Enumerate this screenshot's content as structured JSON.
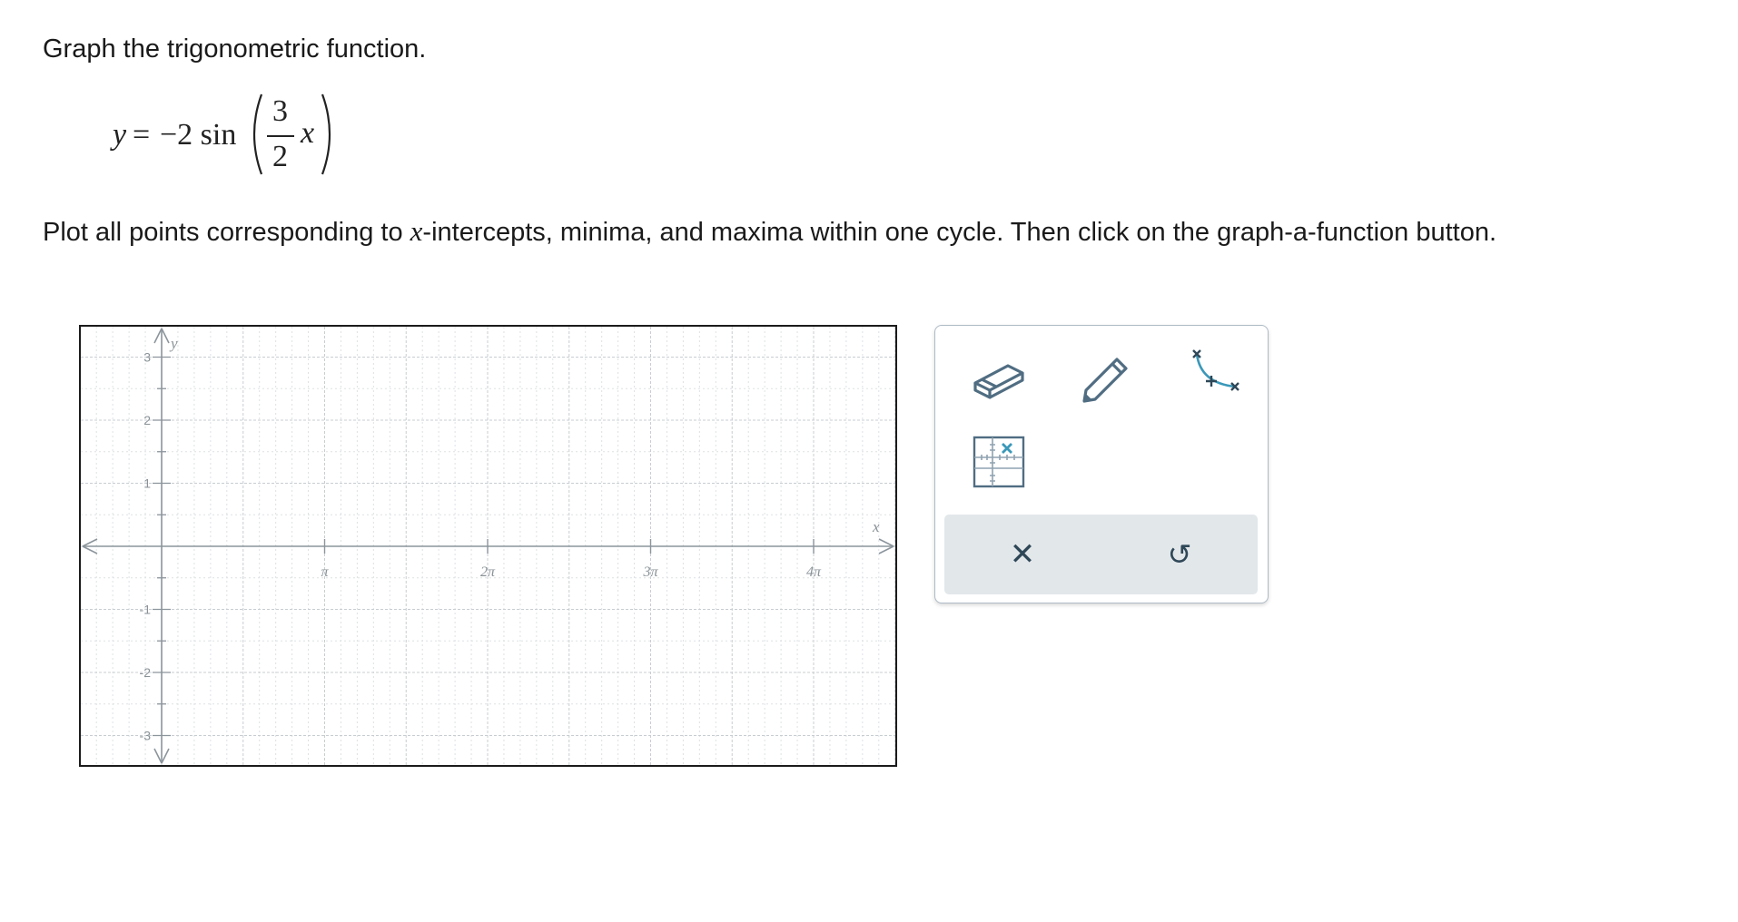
{
  "prompt": "Graph the trigonometric function.",
  "equation": {
    "lhs": "y",
    "equals": "=",
    "coefficient": "−2 sin",
    "numerator": "3",
    "denominator": "2",
    "variable": "x"
  },
  "instructions": {
    "before": "Plot all points corresponding to ",
    "var": "x",
    "after": "-intercepts, minima, and maxima within one cycle. Then click on the graph-a-function button."
  },
  "graph": {
    "x_axis_label": "x",
    "y_axis_label": "y",
    "x_tick_labels": [
      "π",
      "2π",
      "3π",
      "4π"
    ],
    "y_tick_labels": [
      "3",
      "2",
      "1",
      "-1",
      "-2",
      "-3"
    ],
    "x_range": [
      "-π/2",
      "4.5π"
    ],
    "y_range": [
      -3.5,
      3.5
    ],
    "grid": true
  },
  "toolbox": {
    "tools": [
      "eraser-tool",
      "pencil-tool",
      "graph-a-function-tool",
      "point-plot-tool"
    ],
    "clear_symbol": "✕",
    "undo_symbol": "↺",
    "accent": "#3a98b9",
    "icon_color": "#506d82"
  }
}
